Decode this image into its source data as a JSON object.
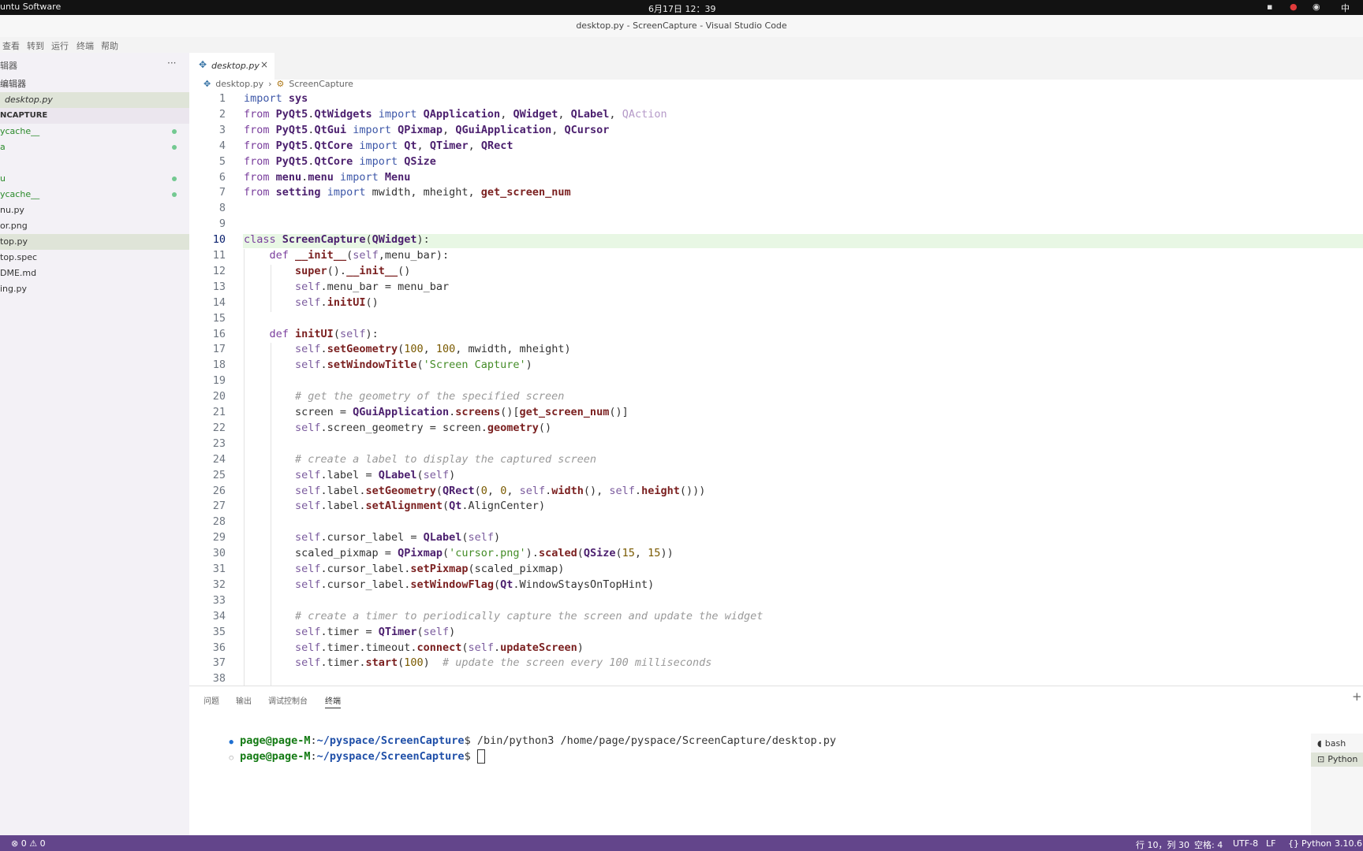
{
  "topbar": {
    "app": "untu Software",
    "clock": "6月17日 12：39",
    "tray_right": "中"
  },
  "window": {
    "title": "desktop.py - ScreenCapture - Visual Studio Code"
  },
  "menu": [
    "查看",
    "转到",
    "运行",
    "终端",
    "帮助"
  ],
  "sidebar": {
    "header": "辑器",
    "more": "···",
    "open_editors_label": "编辑器",
    "open_file": "desktop.py",
    "project": "NCAPTURE",
    "items": [
      {
        "label": "ycache__",
        "dot": true,
        "green": true
      },
      {
        "label": "a",
        "dot": true,
        "green": true
      },
      {
        "label": "",
        "dot": false,
        "green": false
      },
      {
        "label": "u",
        "dot": true,
        "green": true
      },
      {
        "label": "ycache__",
        "dot": true,
        "green": true
      },
      {
        "label": "nu.py",
        "dot": false,
        "green": false
      },
      {
        "label": "or.png",
        "dot": false,
        "green": false
      },
      {
        "label": "top.py",
        "dot": false,
        "green": false,
        "selected": true
      },
      {
        "label": "top.spec",
        "dot": false,
        "green": false
      },
      {
        "label": "DME.md",
        "dot": false,
        "green": false
      },
      {
        "label": "ing.py",
        "dot": false,
        "green": false
      }
    ]
  },
  "tab": {
    "label": "desktop.py",
    "close": "×"
  },
  "breadcrumb": {
    "file": "desktop.py",
    "symbol": "ScreenCapture"
  },
  "editor": {
    "current_line": 10,
    "lines": [
      "import sys",
      "from PyQt5.QtWidgets import QApplication, QWidget, QLabel, QAction",
      "from PyQt5.QtGui import QPixmap, QGuiApplication, QCursor",
      "from PyQt5.QtCore import Qt, QTimer, QRect",
      "from PyQt5.QtCore import QSize",
      "from menu.menu import Menu",
      "from setting import mwidth, mheight, get_screen_num",
      "",
      "",
      "class ScreenCapture(QWidget):",
      "    def __init__(self,menu_bar):",
      "        super().__init__()",
      "        self.menu_bar = menu_bar",
      "        self.initUI()",
      "",
      "    def initUI(self):",
      "        self.setGeometry(100, 100, mwidth, mheight)",
      "        self.setWindowTitle('Screen Capture')",
      "",
      "        # get the geometry of the specified screen",
      "        screen = QGuiApplication.screens()[get_screen_num()]",
      "        self.screen_geometry = screen.geometry()",
      "",
      "        # create a label to display the captured screen",
      "        self.label = QLabel(self)",
      "        self.label.setGeometry(QRect(0, 0, self.width(), self.height()))",
      "        self.label.setAlignment(Qt.AlignCenter)",
      "",
      "        self.cursor_label = QLabel(self)",
      "        scaled_pixmap = QPixmap('cursor.png').scaled(QSize(15, 15))",
      "        self.cursor_label.setPixmap(scaled_pixmap)",
      "        self.cursor_label.setWindowFlag(Qt.WindowStaysOnTopHint)",
      "",
      "        # create a timer to periodically capture the screen and update the widget",
      "        self.timer = QTimer(self)",
      "        self.timer.timeout.connect(self.updateScreen)",
      "        self.timer.start(100)  # update the screen every 100 milliseconds",
      ""
    ]
  },
  "panel": {
    "tabs": [
      "问题",
      "输出",
      "调试控制台",
      "终端"
    ],
    "active_tab": "终端",
    "add": "+",
    "terminal": [
      {
        "bullet": "●",
        "user": "page@page-M",
        "path": "~/pyspace/ScreenCapture",
        "cmd": "$ /bin/python3 /home/page/pyspace/ScreenCapture/desktop.py"
      },
      {
        "bullet": "○",
        "user": "page@page-M",
        "path": "~/pyspace/ScreenCapture",
        "cmd": "$ "
      }
    ],
    "terminals": [
      "bash",
      "Python"
    ]
  },
  "status": {
    "problems": "⊗ 0 ⚠ 0",
    "position": "行 10，列 30",
    "indent": "空格: 4",
    "encoding": "UTF-8",
    "eol": "LF",
    "language": "Python",
    "version": "3.10.6"
  },
  "colors": {
    "statusbar": "#63458b",
    "current_line": "#e8f7e4",
    "sidebar_selection": "#dfe4d8"
  }
}
